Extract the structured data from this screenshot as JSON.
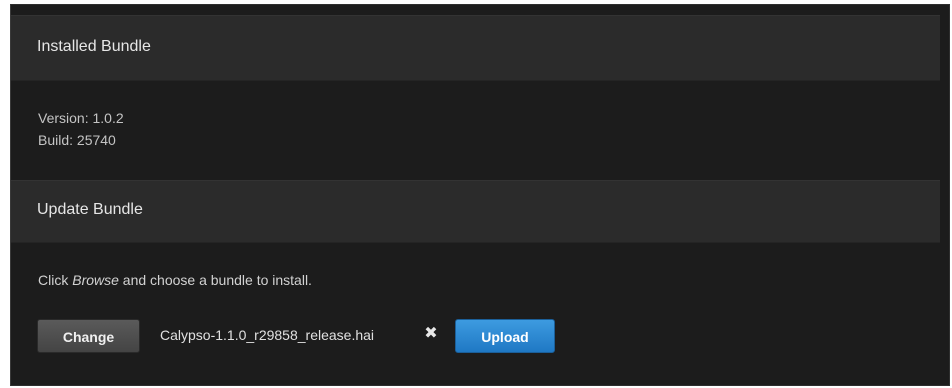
{
  "installed": {
    "title": "Installed Bundle",
    "version_label": "Version: 1.0.2",
    "build_label": "Build: 25740"
  },
  "update": {
    "title": "Update Bundle",
    "instructions_prefix": "Click ",
    "instructions_emphasis": "Browse",
    "instructions_suffix": " and choose a bundle to install.",
    "change_button_label": "Change",
    "selected_file": "Calypso-1.1.0_r29858_release.hai",
    "remove_icon_glyph": "✖",
    "upload_button_label": "Upload"
  },
  "colors": {
    "panel_background": "#1c1c1c",
    "header_background": "#2b2b2b",
    "upload_accent": "#2a86d4"
  }
}
